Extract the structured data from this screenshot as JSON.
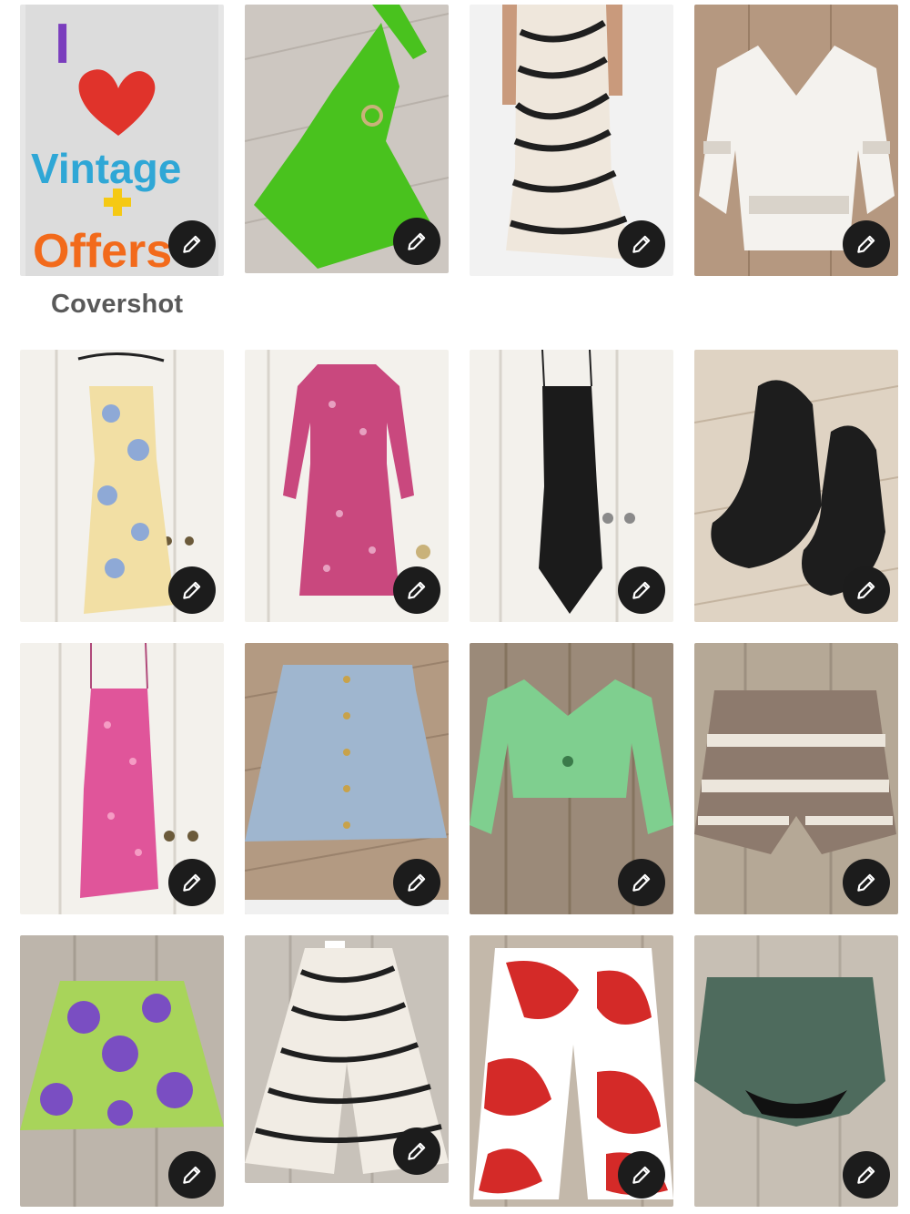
{
  "cover_label": "Covershot",
  "edit_icon": "pencil-icon",
  "photos": [
    {
      "id": "cover-sign",
      "colors": [
        "#e8e8e8",
        "#d0d0d0"
      ],
      "texts": [
        "I",
        "Vintage",
        "Offers"
      ],
      "text_colors": [
        "#7a3dbd",
        "#2fa7d6",
        "#f26a1b"
      ],
      "heart": "#e0332b"
    },
    {
      "id": "green-crochet-top",
      "colors": [
        "#cfcac4",
        "#bdb7b1"
      ],
      "item": "#49c21e"
    },
    {
      "id": "zebra-wrap-dress",
      "colors": [
        "#f2f2f2",
        "#e6e6e6"
      ],
      "item": "#2a2a2a"
    },
    {
      "id": "white-lace-blouse",
      "colors": [
        "#c4a78c",
        "#a88a70"
      ],
      "item": "#f4f2ee"
    },
    {
      "id": "yellow-floral-slip",
      "colors": [
        "#f3f1ec",
        "#e2dfd8"
      ],
      "item": "#f2dfa4"
    },
    {
      "id": "pink-print-dress",
      "colors": [
        "#f3f1ec",
        "#e2dfd8"
      ],
      "item": "#c9487e"
    },
    {
      "id": "black-satin-slip",
      "colors": [
        "#f3f1ec",
        "#e2dfd8"
      ],
      "item": "#1b1b1b"
    },
    {
      "id": "black-bow-slides",
      "colors": [
        "#e3d8c9",
        "#c9b9a6"
      ],
      "item": "#1d1d1d"
    },
    {
      "id": "pink-ruffle-slip",
      "colors": [
        "#f3f1ec",
        "#e2dfd8"
      ],
      "item": "#e0559a"
    },
    {
      "id": "denim-mini-skirt",
      "colors": [
        "#b39a82",
        "#9d8570"
      ],
      "item": "#9fb6cf"
    },
    {
      "id": "green-knit-crop",
      "colors": [
        "#9b8a79",
        "#84735f"
      ],
      "item": "#7fcf8f"
    },
    {
      "id": "crochet-shorts",
      "colors": [
        "#b5a896",
        "#9e9282"
      ],
      "item": "#8d7a6d"
    },
    {
      "id": "purple-floral-skirt",
      "colors": [
        "#bdb5ab",
        "#a59d92"
      ],
      "item": "#7a4ec2"
    },
    {
      "id": "zebra-midi-skirt",
      "colors": [
        "#c8c2ba",
        "#b1aaa1"
      ],
      "item": "#2a2a2a"
    },
    {
      "id": "red-print-pants",
      "colors": [
        "#c3b8aa",
        "#aa9e90"
      ],
      "item": "#d42a28"
    },
    {
      "id": "green-knit-shorts",
      "colors": [
        "#c7bfb4",
        "#b0a89d"
      ],
      "item": "#4e6b5d"
    }
  ]
}
